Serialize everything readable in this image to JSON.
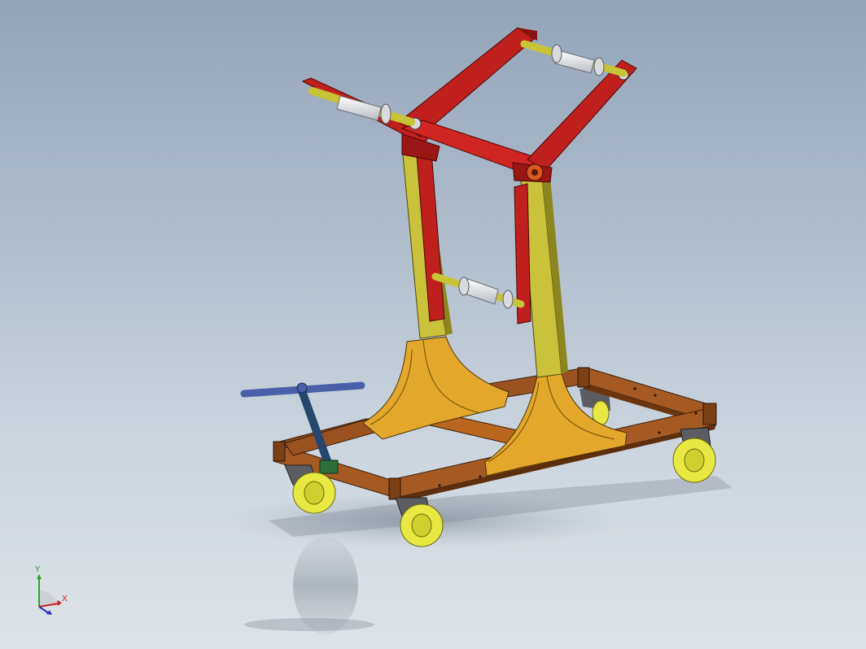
{
  "scene": {
    "background_top": "#93a4b8",
    "background_bottom": "#dde3e8",
    "parts": [
      {
        "name": "base-frame",
        "color": "#8a4a1a"
      },
      {
        "name": "upright-posts",
        "color": "#c9c23a"
      },
      {
        "name": "support-brackets",
        "color": "#e0a52a"
      },
      {
        "name": "swing-arms",
        "color": "#c0201d"
      },
      {
        "name": "rollers",
        "color": "#e8e8ec"
      },
      {
        "name": "axle-shafts",
        "color": "#c8c437"
      },
      {
        "name": "tow-handle",
        "color": "#4a5fa8"
      },
      {
        "name": "caster-wheels",
        "color": "#e8e842"
      }
    ]
  },
  "triad": {
    "y_label": "Y",
    "x_label": "X",
    "y_color": "#2aa12a",
    "x_color": "#cc2222",
    "z_color": "#2233bb"
  }
}
